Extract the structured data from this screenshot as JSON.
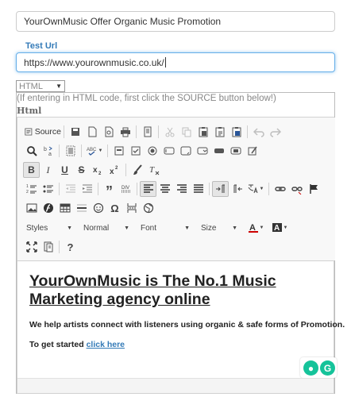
{
  "form": {
    "title_value": "YourOwnMusic Offer Organic Music Promotion",
    "url_label": "Test Url",
    "url_value": "https://www.yourownmusic.co.uk/",
    "format_select": "HTML",
    "hint": "(If entering in HTML code, first click the SOURCE button below!)",
    "html_label": "Html"
  },
  "toolbar": {
    "source_label": "Source",
    "styles_label": "Styles",
    "format_label": "Normal",
    "font_label": "Font",
    "size_label": "Size",
    "italic_glyph": "I",
    "underline_glyph": "U",
    "strike_glyph": "S",
    "bold_glyph": "B",
    "help_glyph": "?"
  },
  "content": {
    "heading": "YourOwnMusic is The No.1 Music Marketing agency online",
    "paragraph": "We help artists connect with listeners using organic & safe forms of Promotion.",
    "cta_prefix": "To get started ",
    "cta_link": "click here"
  },
  "colors": {
    "accent": "#337ab7",
    "grammarly": "#15c39a"
  }
}
